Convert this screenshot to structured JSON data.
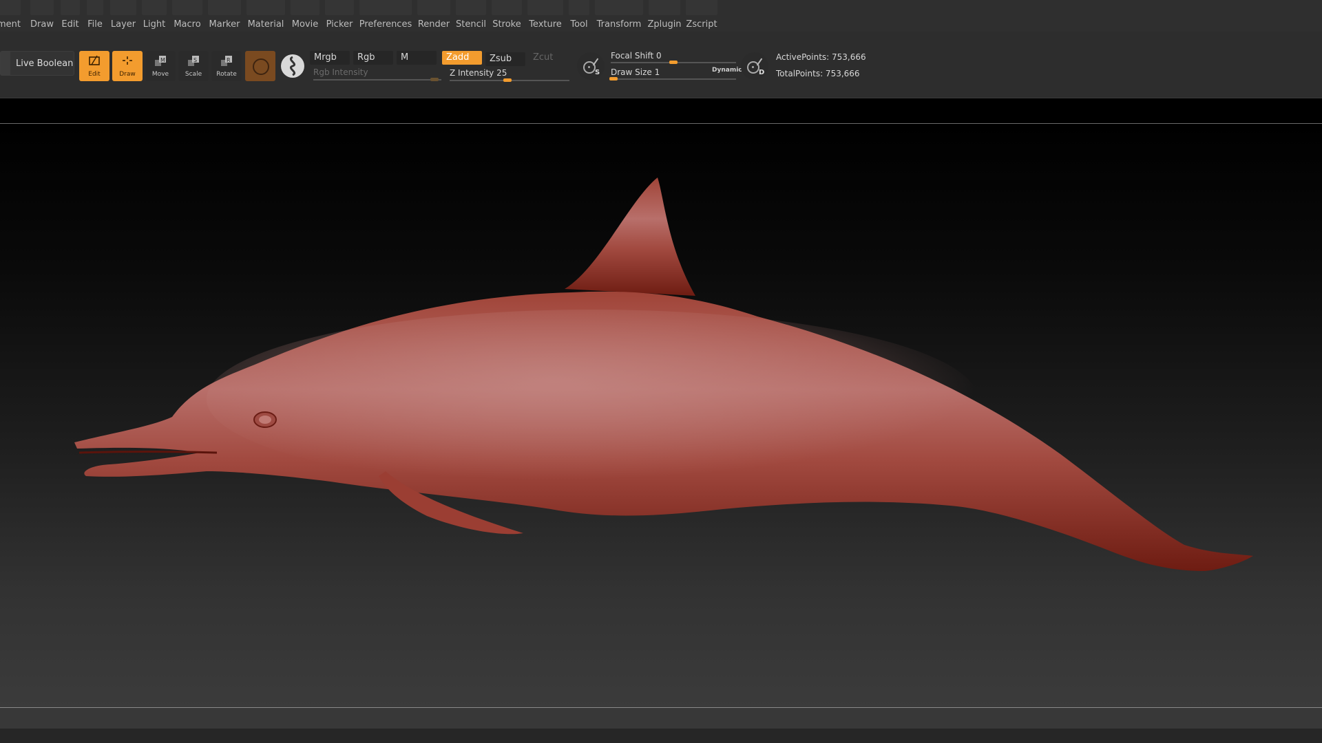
{
  "menu": {
    "items": [
      "ment",
      "Draw",
      "Edit",
      "File",
      "Layer",
      "Light",
      "Macro",
      "Marker",
      "Material",
      "Movie",
      "Picker",
      "Preferences",
      "Render",
      "Stencil",
      "Stroke",
      "Texture",
      "Tool",
      "Transform",
      "Zplugin",
      "Zscript"
    ]
  },
  "toolbar": {
    "live_boolean": "Live Boolean",
    "edit": "Edit",
    "draw": "Draw",
    "move": "Move",
    "scale": "Scale",
    "rotate": "Rotate",
    "mrgb": "Mrgb",
    "rgb": "Rgb",
    "m": "M",
    "zadd": "Zadd",
    "zsub": "Zsub",
    "zcut": "Zcut",
    "rgb_intensity": "Rgb Intensity",
    "z_intensity_label": "Z Intensity",
    "z_intensity_value": "25",
    "z_intensity_level": 0.25,
    "focal_shift_label": "Focal Shift",
    "focal_shift_value": "0",
    "draw_size_label": "Draw Size",
    "draw_size_value": "1",
    "dynamic": "Dynamic",
    "brush_s_letter": "S",
    "brush_d_letter": "D",
    "active_points": "ActivePoints: 753,666",
    "total_points": "TotalPoints: 753,666",
    "icons": [
      "edit-icon",
      "draw-icon",
      "move-icon",
      "scale-icon",
      "rotate-icon",
      "material-icon",
      "sphere-icon",
      "brush-icon"
    ]
  },
  "viewport": {
    "subject": "dolphin-model",
    "model_color": "#b0554a",
    "accent_color": "#f39c2e"
  }
}
